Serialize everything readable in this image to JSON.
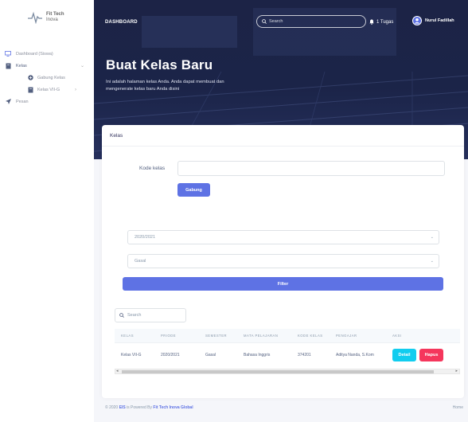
{
  "logo": {
    "line1": "Fit Tech",
    "line2": "Inova"
  },
  "sidebar": {
    "items": [
      {
        "label": "Dashboard (Siswa)",
        "icon": "monitor-icon"
      },
      {
        "label": "Kelas",
        "icon": "book-icon"
      },
      {
        "label": "Gabung Kelas",
        "icon": "plus-circle-icon"
      },
      {
        "label": "Kelas VII-G",
        "icon": "book-icon"
      },
      {
        "label": "Pesan",
        "icon": "send-icon"
      }
    ]
  },
  "header": {
    "brand": "DASHBOARD",
    "search_placeholder": "Search",
    "tugas": "1 Tugas",
    "user": "Nurul Fadillah"
  },
  "hero": {
    "title": "Buat Kelas Baru",
    "description": "Ini adalah halaman kelas Anda. Anda dapat membuat dan mengenerate kelas baru Anda disini"
  },
  "card": {
    "header": "Kelas",
    "join_label": "Kode kelas",
    "join_button": "Gabung",
    "year_select": "2020/2021",
    "semester_select": "Gasal",
    "filter_button": "Filter",
    "table_search_placeholder": "Search"
  },
  "table": {
    "headers": [
      "KELAS",
      "PRIODE",
      "SEMESTER",
      "MATA PELAJARAN",
      "KODE KELAS",
      "PENGAJAR",
      "AKSI"
    ],
    "rows": [
      [
        "Kelas VII-G",
        "2020/2021",
        "Gasal",
        "Bahasa Inggris",
        "374201",
        "Aditya Nanda, S.Kom"
      ]
    ],
    "detail_button": "Detail",
    "hapus_button": "Hapus"
  },
  "footer": {
    "prefix": "© 2020",
    "eis": "EIS",
    "middle": "is Powered By",
    "company": "Fit Tech Inova Global",
    "home": "Home"
  },
  "colors": {
    "primary": "#5e72e4",
    "info": "#11cdef",
    "danger": "#f5365c",
    "hero": "#1c2346"
  }
}
